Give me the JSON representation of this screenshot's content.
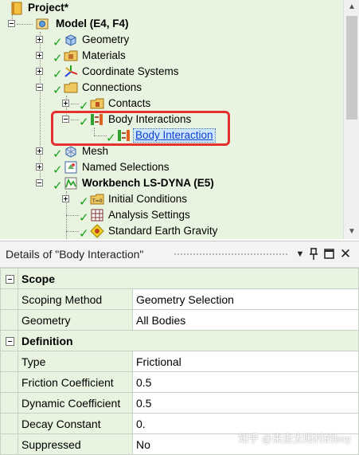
{
  "tree": {
    "project": "Project*",
    "model": "Model (E4, F4)",
    "geometry": "Geometry",
    "materials": "Materials",
    "coordinate_systems": "Coordinate Systems",
    "connections": "Connections",
    "contacts": "Contacts",
    "body_interactions": "Body Interactions",
    "body_interaction": "Body Interaction",
    "mesh": "Mesh",
    "named_selections": "Named Selections",
    "workbench": "Workbench LS-DYNA (E5)",
    "initial_conditions": "Initial Conditions",
    "analysis_settings": "Analysis Settings",
    "standard_earth_gravity": "Standard Earth Gravity"
  },
  "details": {
    "title": "Details of \"Body Interaction\"",
    "pin_icon": "ㄗ",
    "sections": [
      {
        "label": "Scope",
        "rows": [
          {
            "name": "Scoping Method",
            "value": "Geometry Selection"
          },
          {
            "name": "Geometry",
            "value": "All Bodies"
          }
        ]
      },
      {
        "label": "Definition",
        "rows": [
          {
            "name": "Type",
            "value": "Frictional"
          },
          {
            "name": "Friction Coefficient",
            "value": "0.5"
          },
          {
            "name": "Dynamic Coefficient",
            "value": "0.5"
          },
          {
            "name": "Decay Constant",
            "value": "0."
          },
          {
            "name": "Suppressed",
            "value": "No"
          }
        ]
      }
    ]
  },
  "watermark": "知乎 @来自太阳村的boy",
  "colors": {
    "tree_bg": "#e8f4e0",
    "check": "#18a018",
    "highlight_box": "#e53030",
    "selected_text": "#0a3fd0"
  }
}
